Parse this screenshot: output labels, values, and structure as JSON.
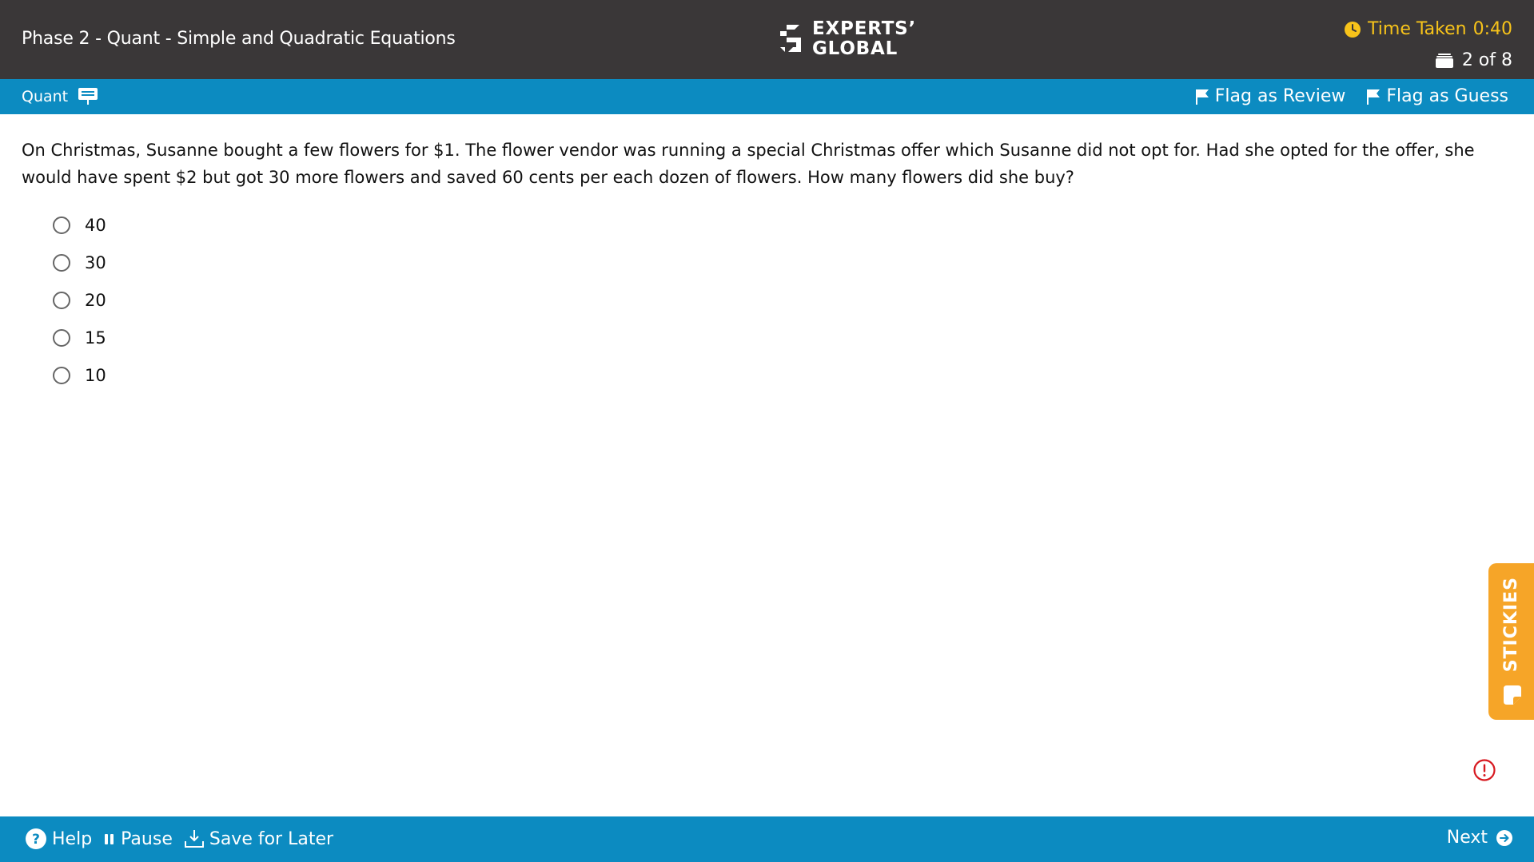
{
  "header": {
    "section_title": "Phase 2 - Quant - Simple and Quadratic Equations",
    "logo": {
      "line1": "EXPERTS’",
      "line2": "GLOBAL"
    },
    "timer": {
      "label": "Time Taken",
      "value": "0:40",
      "icon": "clock-icon"
    },
    "counter": {
      "text": "2 of 8",
      "icon": "stack-icon"
    }
  },
  "subbar": {
    "subject": "Quant",
    "subject_icon": "calculator-board-icon",
    "flag_review": "Flag as Review",
    "flag_guess": "Flag as Guess"
  },
  "question": {
    "text": "On Christmas, Susanne bought a few flowers for $1.  The flower vendor was running a special Christmas offer which Susanne did not opt for. Had she opted for the offer, she would have spent $2 but got 30 more flowers and saved 60 cents per each dozen of flowers. How many flowers did she buy?",
    "options": [
      "40",
      "30",
      "20",
      "15",
      "10"
    ]
  },
  "stickies": {
    "label": "STICKIES"
  },
  "footer": {
    "help": "Help",
    "pause": "Pause",
    "save": "Save for Later",
    "next": "Next"
  },
  "colors": {
    "topbar": "#3a3738",
    "accent_blue": "#0c8bc1",
    "timer_yellow": "#f7c31a",
    "stickies_orange": "#f6a528",
    "report_red": "#d71920"
  }
}
